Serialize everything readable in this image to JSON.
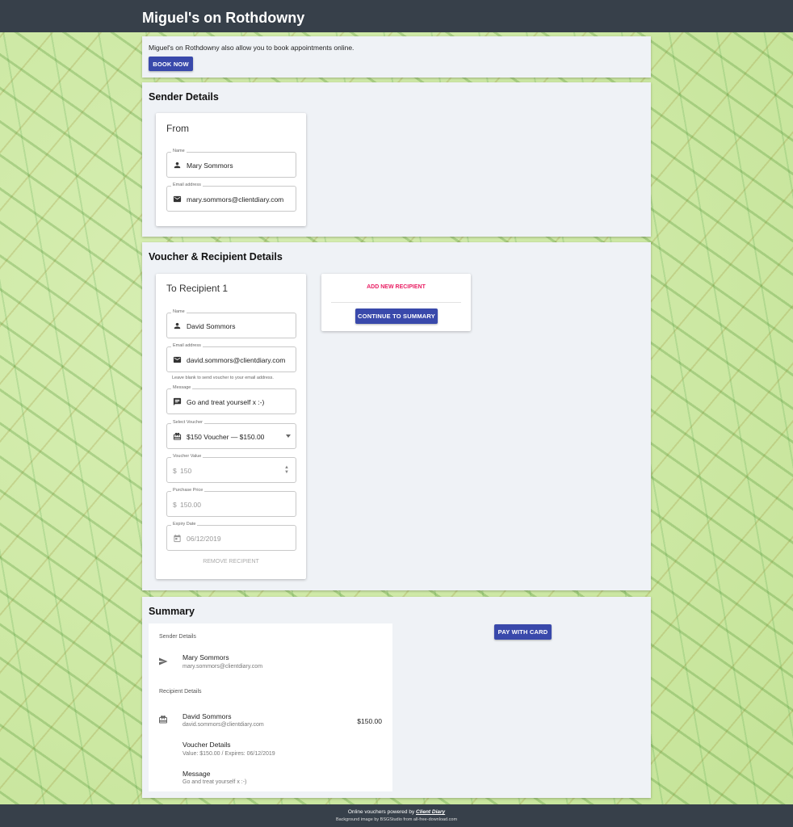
{
  "header": {
    "title": "Miguel's on Rothdowny"
  },
  "intro": {
    "text": "Miguel's on Rothdowny also allow you to book appointments online.",
    "book_button": "BOOK NOW"
  },
  "sender": {
    "section_title": "Sender Details",
    "card_title": "From",
    "name_label": "Name",
    "name_value": "Mary Sommors",
    "email_label": "Email address",
    "email_value": "mary.sommors@clientdiary.com"
  },
  "voucher": {
    "section_title": "Voucher & Recipient Details",
    "card_title": "To Recipient 1",
    "name_label": "Name",
    "name_value": "David Sommors",
    "email_label": "Email address",
    "email_value": "david.sommors@clientdiary.com",
    "email_hint": "Leave blank to send voucher to your email address.",
    "message_label": "Message",
    "message_value": "Go and treat yourself x  :-)",
    "select_label": "Select Voucher",
    "select_value": "$150 Voucher — $150.00",
    "value_label": "Voucher Value",
    "value_prefix": "$",
    "value_value": "150",
    "price_label": "Purchase Price",
    "price_prefix": "$",
    "price_value": "150.00",
    "expiry_label": "Expiry Date",
    "expiry_value": "06/12/2019",
    "remove_button": "REMOVE RECIPIENT",
    "add_recipient": "ADD NEW RECIPIENT",
    "continue_button": "CONTINUE TO SUMMARY"
  },
  "summary": {
    "section_title": "Summary",
    "sender_heading": "Sender Details",
    "sender_name": "Mary Sommors",
    "sender_email": "mary.sommors@clientdiary.com",
    "recipient_heading": "Recipient Details",
    "recipient_name": "David Sommors",
    "recipient_email": "david.sommors@clientdiary.com",
    "recipient_price": "$150.00",
    "voucher_details_label": "Voucher Details",
    "voucher_details_value": "Value: $150.00 / Expires: 06/12/2019",
    "message_label": "Message",
    "message_value": "Go and treat yourself x :-)",
    "pay_button": "PAY WITH CARD"
  },
  "footer": {
    "line1_prefix": "Online vouchers powered by",
    "line1_brand": "Client Diary",
    "line2": "Background image by BSGStudio from all-free-download.com"
  },
  "colors": {
    "accent": "#3949ab",
    "pink": "#e91e63",
    "topbar": "#37404a",
    "panel": "#eff2f6"
  }
}
